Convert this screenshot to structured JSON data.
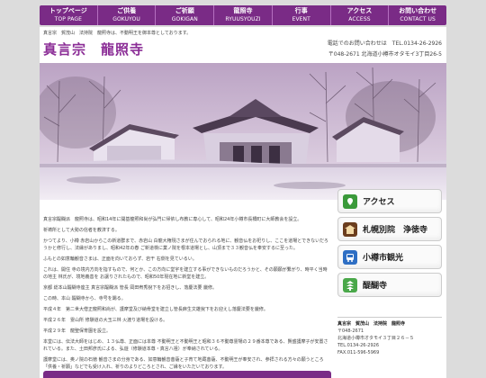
{
  "nav": [
    {
      "jp": "トップページ",
      "en": "TOP PAGE"
    },
    {
      "jp": "ご供養",
      "en": "GOKUYOU"
    },
    {
      "jp": "ご祈願",
      "en": "GOKIGAN"
    },
    {
      "jp": "龍照寺",
      "en": "RYUUSYOUZI"
    },
    {
      "jp": "行事",
      "en": "EVENT"
    },
    {
      "jp": "アクセス",
      "en": "ACCESS"
    },
    {
      "jp": "お問い合わせ",
      "en": "CONTACT US"
    }
  ],
  "breadcrumb": "真言宗　賀茂山　法持院　龍照寺は、不動明王を御本尊としております。",
  "site_title": "真言宗　龍照寺",
  "contact": {
    "line1": "電話でのお問い合わせは　TEL.0134-26-2926",
    "line2": "〒048-2671 北海道小樽市オタモイ3丁目26-5"
  },
  "main_paragraphs": [
    "真言宗醍醐派　龍照寺は、昭和14年に開基龍照和尚が弘門に帰依し布教に専心して、昭和24年小樽市長橋町に大師教会を設立。",
    "祈祷所として大勢の信者を教済する。",
    "かつてより、小樽 赤岩山からこの新道群まで、赤岩山 白龍大権現さまが住んでおられる地に、観音仏をお祀りし、ここを道場とできないだろうかと修行し、法縁がありまし、昭和42年の春 ご新道検に業ノ院を根本道場とし、山頂まで３３観音仏を奉安するに至った。",
    "ふもとの如意輪観音さまは、正面を向いておらず、岩干 右側を見ているい。",
    "これは、開住 寺の境内方向を指すもので、何とか、この方向に堂宇を建立する事ができないものだろうかと、その願願が繋がり、時平く当時の地主 林氏が、境地義善を お譲りされたもので、昭和50年現在地に新堂を建立。",
    "京都 総本山醍醐寺座主 真言宗醍醐派 管長 岡田宥秀猊下をお招きし、落慶法要 厳修。",
    "この時、本山 醍醐寺から、寺号を賜る。",
    "平成４年　第二世大僧正龍照和尚が、護摩堂及び納骨堂を建立し管長麻生文雄猊下をお迎えし落慶法要を厳修。",
    "平成２６年　霊山所 修験道の大玉三林 火渡り道場を設ける。",
    "平成２９年　龍聖保育園を設立。",
    "本堂には、伝法大師をはじめ、１３仏尊、正面には本尊 不動明王と不動明王と昭和３６不動尊霊場の２９番本尊である、賢盛護摩子が安置されている。また、土田邦彦氏による、弘遊（修験道本尊・真言八祖）が奉納されている。",
    "護摩堂には、奥ノ院の石徳 観音さまの分身である、如意輪観音菩薩と子育て地蔵菩薩、不動明王が奉安され、参拝される方々の願うところ「供養・祈願」などでも受け入れ、祈りのよりどころとされ、ご縁をいただいております。"
  ],
  "banners": [
    {
      "label": "アクセス",
      "icon": "map-icon",
      "color": "#3a9a3a"
    },
    {
      "label": "札幌別院　浄徳寺",
      "icon": "temple-icon",
      "color": "#6b3d1e"
    },
    {
      "label": "小樽市観光",
      "icon": "bus-icon",
      "color": "#2e6fc4"
    },
    {
      "label": "醍醐寺",
      "icon": "pagoda-icon",
      "color": "#4aa84a"
    }
  ],
  "address_box": {
    "title": "真言宗　賀茂山　法持院　龍照寺",
    "zip": "〒048-2671",
    "address": "北海道小樽市オタモイ３丁目２６－５",
    "tel": "TEL.0134-26-2926",
    "fax": "FAX.011-596-5969"
  },
  "colors": {
    "accent": "#7a2b86",
    "title": "#8b2d96"
  }
}
